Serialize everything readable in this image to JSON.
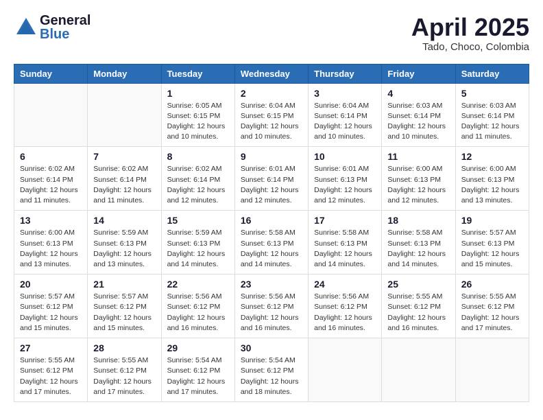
{
  "header": {
    "logo_general": "General",
    "logo_blue": "Blue",
    "title": "April 2025",
    "subtitle": "Tado, Choco, Colombia"
  },
  "calendar": {
    "days_of_week": [
      "Sunday",
      "Monday",
      "Tuesday",
      "Wednesday",
      "Thursday",
      "Friday",
      "Saturday"
    ],
    "weeks": [
      [
        {
          "day": "",
          "detail": ""
        },
        {
          "day": "",
          "detail": ""
        },
        {
          "day": "1",
          "detail": "Sunrise: 6:05 AM\nSunset: 6:15 PM\nDaylight: 12 hours and 10 minutes."
        },
        {
          "day": "2",
          "detail": "Sunrise: 6:04 AM\nSunset: 6:15 PM\nDaylight: 12 hours and 10 minutes."
        },
        {
          "day": "3",
          "detail": "Sunrise: 6:04 AM\nSunset: 6:14 PM\nDaylight: 12 hours and 10 minutes."
        },
        {
          "day": "4",
          "detail": "Sunrise: 6:03 AM\nSunset: 6:14 PM\nDaylight: 12 hours and 10 minutes."
        },
        {
          "day": "5",
          "detail": "Sunrise: 6:03 AM\nSunset: 6:14 PM\nDaylight: 12 hours and 11 minutes."
        }
      ],
      [
        {
          "day": "6",
          "detail": "Sunrise: 6:02 AM\nSunset: 6:14 PM\nDaylight: 12 hours and 11 minutes."
        },
        {
          "day": "7",
          "detail": "Sunrise: 6:02 AM\nSunset: 6:14 PM\nDaylight: 12 hours and 11 minutes."
        },
        {
          "day": "8",
          "detail": "Sunrise: 6:02 AM\nSunset: 6:14 PM\nDaylight: 12 hours and 12 minutes."
        },
        {
          "day": "9",
          "detail": "Sunrise: 6:01 AM\nSunset: 6:14 PM\nDaylight: 12 hours and 12 minutes."
        },
        {
          "day": "10",
          "detail": "Sunrise: 6:01 AM\nSunset: 6:13 PM\nDaylight: 12 hours and 12 minutes."
        },
        {
          "day": "11",
          "detail": "Sunrise: 6:00 AM\nSunset: 6:13 PM\nDaylight: 12 hours and 12 minutes."
        },
        {
          "day": "12",
          "detail": "Sunrise: 6:00 AM\nSunset: 6:13 PM\nDaylight: 12 hours and 13 minutes."
        }
      ],
      [
        {
          "day": "13",
          "detail": "Sunrise: 6:00 AM\nSunset: 6:13 PM\nDaylight: 12 hours and 13 minutes."
        },
        {
          "day": "14",
          "detail": "Sunrise: 5:59 AM\nSunset: 6:13 PM\nDaylight: 12 hours and 13 minutes."
        },
        {
          "day": "15",
          "detail": "Sunrise: 5:59 AM\nSunset: 6:13 PM\nDaylight: 12 hours and 14 minutes."
        },
        {
          "day": "16",
          "detail": "Sunrise: 5:58 AM\nSunset: 6:13 PM\nDaylight: 12 hours and 14 minutes."
        },
        {
          "day": "17",
          "detail": "Sunrise: 5:58 AM\nSunset: 6:13 PM\nDaylight: 12 hours and 14 minutes."
        },
        {
          "day": "18",
          "detail": "Sunrise: 5:58 AM\nSunset: 6:13 PM\nDaylight: 12 hours and 14 minutes."
        },
        {
          "day": "19",
          "detail": "Sunrise: 5:57 AM\nSunset: 6:13 PM\nDaylight: 12 hours and 15 minutes."
        }
      ],
      [
        {
          "day": "20",
          "detail": "Sunrise: 5:57 AM\nSunset: 6:12 PM\nDaylight: 12 hours and 15 minutes."
        },
        {
          "day": "21",
          "detail": "Sunrise: 5:57 AM\nSunset: 6:12 PM\nDaylight: 12 hours and 15 minutes."
        },
        {
          "day": "22",
          "detail": "Sunrise: 5:56 AM\nSunset: 6:12 PM\nDaylight: 12 hours and 16 minutes."
        },
        {
          "day": "23",
          "detail": "Sunrise: 5:56 AM\nSunset: 6:12 PM\nDaylight: 12 hours and 16 minutes."
        },
        {
          "day": "24",
          "detail": "Sunrise: 5:56 AM\nSunset: 6:12 PM\nDaylight: 12 hours and 16 minutes."
        },
        {
          "day": "25",
          "detail": "Sunrise: 5:55 AM\nSunset: 6:12 PM\nDaylight: 12 hours and 16 minutes."
        },
        {
          "day": "26",
          "detail": "Sunrise: 5:55 AM\nSunset: 6:12 PM\nDaylight: 12 hours and 17 minutes."
        }
      ],
      [
        {
          "day": "27",
          "detail": "Sunrise: 5:55 AM\nSunset: 6:12 PM\nDaylight: 12 hours and 17 minutes."
        },
        {
          "day": "28",
          "detail": "Sunrise: 5:55 AM\nSunset: 6:12 PM\nDaylight: 12 hours and 17 minutes."
        },
        {
          "day": "29",
          "detail": "Sunrise: 5:54 AM\nSunset: 6:12 PM\nDaylight: 12 hours and 17 minutes."
        },
        {
          "day": "30",
          "detail": "Sunrise: 5:54 AM\nSunset: 6:12 PM\nDaylight: 12 hours and 18 minutes."
        },
        {
          "day": "",
          "detail": ""
        },
        {
          "day": "",
          "detail": ""
        },
        {
          "day": "",
          "detail": ""
        }
      ]
    ]
  }
}
